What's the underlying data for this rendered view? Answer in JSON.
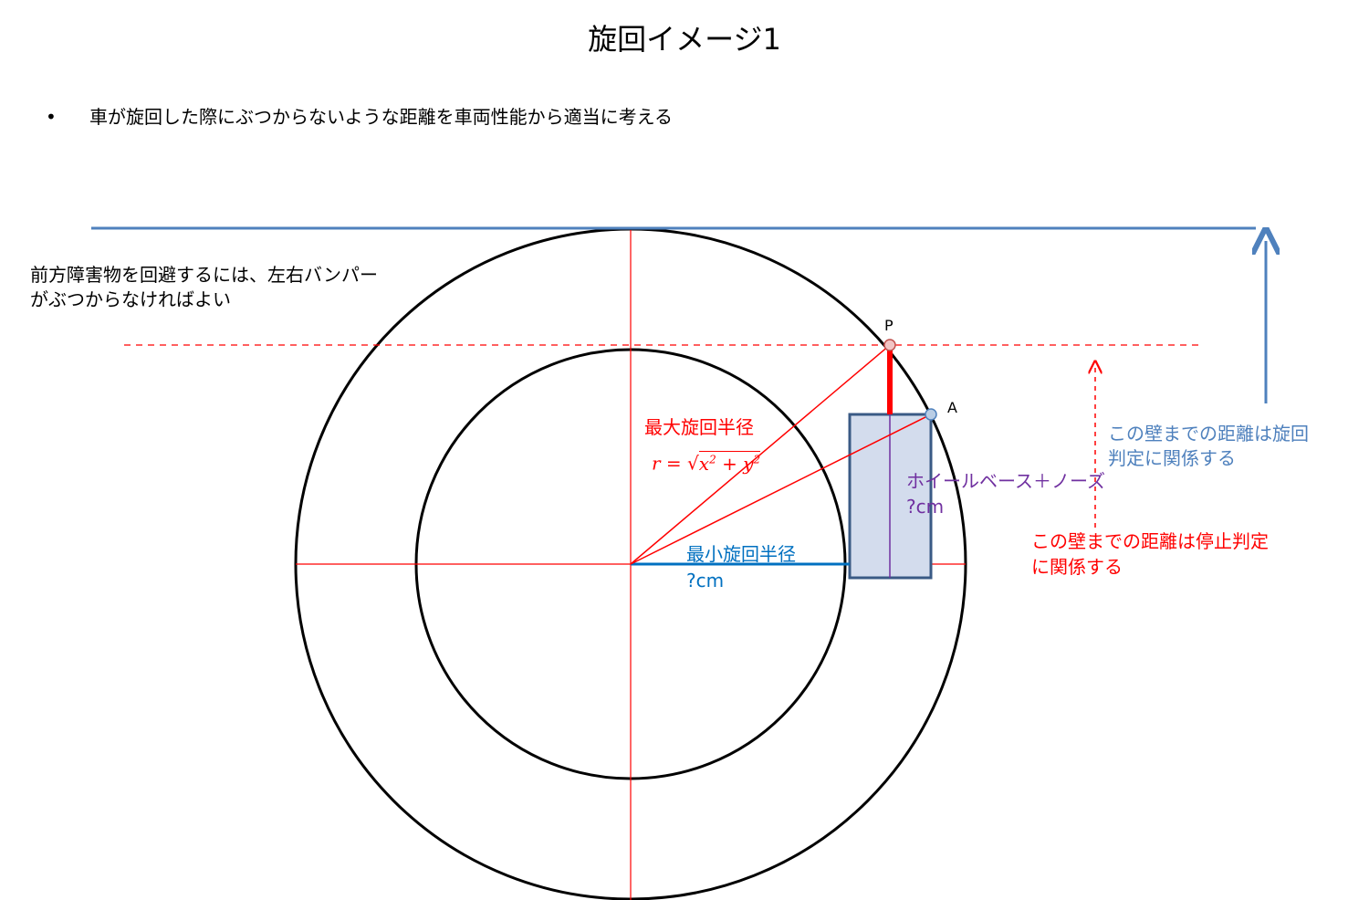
{
  "title": "旋回イメージ1",
  "bullet": {
    "marker": "•",
    "text": "車が旋回した際にぶつからないような距離を車両性能から適当に考える"
  },
  "notes": {
    "obstacle_line1": "前方障害物を回避するには、左右バンパー",
    "obstacle_line2": "がぶつからなければよい",
    "max_radius_label": "最大旋回半径",
    "formula": {
      "lhs": "r",
      "eq": "=",
      "x": "x",
      "y": "y",
      "exp": "2",
      "plus": "+"
    },
    "min_radius_label": "最小旋回半径",
    "min_radius_value": "?cm",
    "wheelbase_label": "ホイールベース＋ノーズ",
    "wheelbase_value": "?cm",
    "turn_wall_line1": "この壁までの距離は旋回",
    "turn_wall_line2": "判定に関係する",
    "stop_wall_line1": "この壁までの距離は停止判定",
    "stop_wall_line2": "に関係する",
    "point_p": "P",
    "point_a": "A"
  },
  "colors": {
    "red": "#ff0000",
    "wall_blue": "#4f81bd",
    "radius_blue": "#0070c0",
    "purple": "#7030a0",
    "car_fill": "#d3dced",
    "car_stroke": "#3a5a85"
  }
}
